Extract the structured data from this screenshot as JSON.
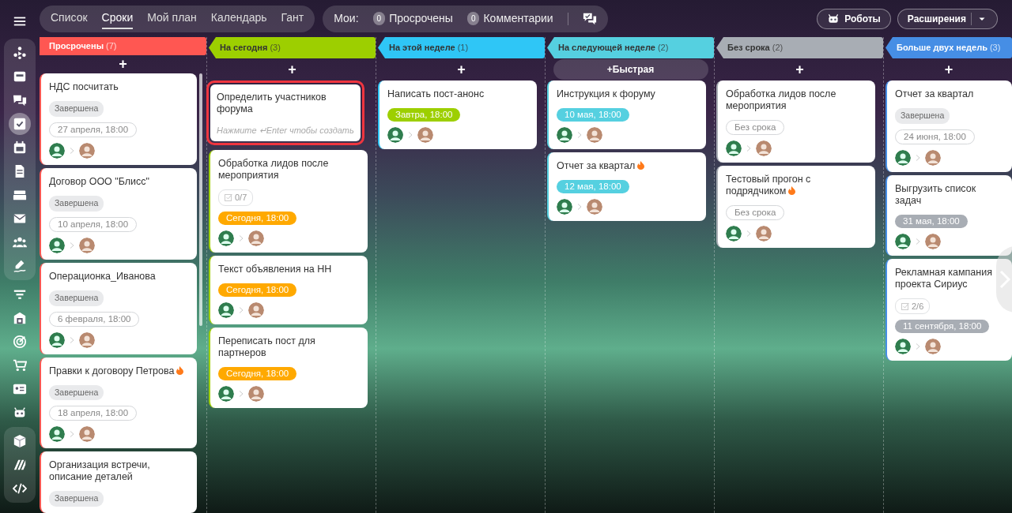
{
  "sidebar": {
    "groups": [
      {
        "panel": true,
        "items": [
          {
            "selected": false
          },
          {
            "selected": false
          },
          {
            "selected": false
          },
          {
            "selected": true
          },
          {
            "selected": false
          },
          {
            "selected": false
          },
          {
            "selected": false
          },
          {
            "selected": false
          },
          {
            "selected": false
          },
          {
            "selected": false
          }
        ]
      },
      {
        "panel": false,
        "items": [
          {
            "selected": false
          },
          {
            "selected": false
          },
          {
            "selected": false
          },
          {
            "selected": false
          },
          {
            "selected": false
          },
          {
            "selected": false
          }
        ]
      },
      {
        "panel": true,
        "items": [
          {
            "selected": false
          },
          {
            "selected": false
          },
          {
            "selected": false
          }
        ]
      }
    ]
  },
  "view_tabs": [
    {
      "label": "Список",
      "selected": false
    },
    {
      "label": "Сроки",
      "selected": true
    },
    {
      "label": "Мой план",
      "selected": false
    },
    {
      "label": "Календарь",
      "selected": false
    },
    {
      "label": "Гант",
      "selected": false
    }
  ],
  "counters": {
    "label": "Мои:",
    "items": [
      {
        "count": "0",
        "label": "Просрочены"
      },
      {
        "count": "0",
        "label": "Комментарии"
      }
    ]
  },
  "actions": [
    {
      "kind": "robots",
      "label": "Роботы"
    },
    {
      "kind": "split",
      "label": "Расширения"
    }
  ],
  "columns": [
    {
      "title": "Просрочены",
      "count": "(7)",
      "color": "#ff5752",
      "add": {
        "icon": "+"
      },
      "cards": [
        {
          "title": "НДС посчитать",
          "fire": false,
          "status": "Завершена",
          "deadline": {
            "text": "27 апреля, 18:00",
            "filled": false
          }
        },
        {
          "title": "Договор ООО \"Блисс\"",
          "fire": false,
          "status": "Завершена",
          "deadline": {
            "text": "10 апреля, 18:00",
            "filled": false
          }
        },
        {
          "title": "Операционка_Иванова",
          "fire": false,
          "status": "Завершена",
          "deadline": {
            "text": "6 февраля, 18:00",
            "filled": false
          }
        },
        {
          "title": "Правки к договору Петрова",
          "fire": true,
          "status": "Завершена",
          "deadline": {
            "text": "18 апреля, 18:00",
            "filled": false
          }
        },
        {
          "title": "Организация встречи, описание деталей",
          "fire": false,
          "status": "Завершена"
        }
      ]
    },
    {
      "title": "На сегодня",
      "count": "(3)",
      "color": "#9dcf00",
      "add": {
        "icon": "+"
      },
      "new_task": {
        "title": "Определить участников форума",
        "hint": "Нажмите ↵Enter чтобы создать",
        "highlighted": true
      },
      "cards": [
        {
          "title": "Обработка лидов после мероприятия",
          "fire": false,
          "checklist": "0/7",
          "deadline": {
            "text": "Сегодня, 18:00",
            "filled": true,
            "color": "#ffa900"
          }
        },
        {
          "title": "Текст объявления на НН",
          "fire": false,
          "deadline": {
            "text": "Сегодня, 18:00",
            "filled": true,
            "color": "#ffa900"
          }
        },
        {
          "title": "Переписать пост для партнеров",
          "fire": false,
          "deadline": {
            "text": "Сегодня, 18:00",
            "filled": true,
            "color": "#ffa900"
          }
        }
      ]
    },
    {
      "title": "На этой неделе",
      "count": "(1)",
      "color": "#2fc6f6",
      "add": {
        "icon": "+"
      },
      "cards": [
        {
          "title": "Написать пост-анонс",
          "fire": false,
          "deadline": {
            "text": "Завтра, 18:00",
            "filled": true,
            "color": "#9dcf00"
          }
        }
      ]
    },
    {
      "title": "На следующей неделе",
      "count": "(2)",
      "color": "#55d0e0",
      "add": {
        "icon": "+",
        "label": "Быстрая"
      },
      "cards": [
        {
          "title": "Инструкция к форуму",
          "fire": false,
          "deadline": {
            "text": "10 мая, 18:00",
            "filled": true,
            "color": "#55d0e0"
          }
        },
        {
          "title": "Отчет за квартал",
          "fire": true,
          "deadline": {
            "text": "12 мая, 18:00",
            "filled": true,
            "color": "#55d0e0"
          }
        }
      ]
    },
    {
      "title": "Без срока",
      "count": "(2)",
      "color": "#a8adb4",
      "add": {
        "icon": "+"
      },
      "cards": [
        {
          "title": "Обработка лидов после мероприятия",
          "fire": false,
          "deadline": {
            "text": "Без срока",
            "filled": false
          }
        },
        {
          "title": "Тестовый прогон с подрядчиком",
          "fire": true,
          "deadline": {
            "text": "Без срока",
            "filled": false
          }
        }
      ]
    },
    {
      "title": "Больше двух недель",
      "count": "(3)",
      "color": "#468ee5",
      "add": {
        "icon": "+"
      },
      "cards": [
        {
          "title": "Отчет за квартал",
          "fire": false,
          "status": "Завершена",
          "deadline": {
            "text": "24 июня, 18:00",
            "filled": false
          }
        },
        {
          "title": "Выгрузить список задач",
          "fire": false,
          "deadline": {
            "text": "31 мая, 18:00",
            "filled": true,
            "color": "#a8adb4"
          }
        },
        {
          "title": "Рекламная кампания проекта Сириус",
          "fire": false,
          "checklist": "2/6",
          "deadline": {
            "text": "11 сентября, 18:00",
            "filled": true,
            "color": "#a8adb4"
          }
        }
      ]
    }
  ]
}
